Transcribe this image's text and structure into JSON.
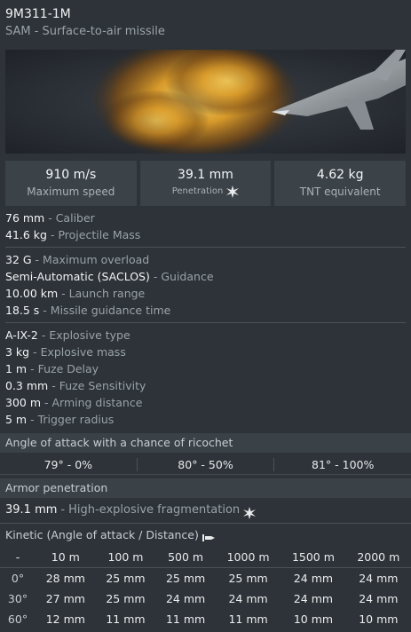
{
  "header": {
    "title": "9M311-1M",
    "subtitle": "SAM - Surface-to-air missile"
  },
  "image": {
    "icon": "missile-explosion-image"
  },
  "stats": [
    {
      "value": "910 m/s",
      "label": "Maximum speed"
    },
    {
      "value": "39.1 mm",
      "label": "Penetration",
      "icon": "he-burst-icon"
    },
    {
      "value": "4.62 kg",
      "label": "TNT equivalent"
    }
  ],
  "group1": [
    {
      "value": "76 mm",
      "key": "Caliber"
    },
    {
      "value": "41.6 kg",
      "key": "Projectile Mass"
    }
  ],
  "group2": [
    {
      "value": "32 G",
      "key": "Maximum overload"
    },
    {
      "value": "Semi-Automatic (SACLOS)",
      "key": "Guidance"
    },
    {
      "value": "10.00 km",
      "key": "Launch range"
    },
    {
      "value": "18.5 s",
      "key": "Missile guidance time"
    }
  ],
  "group3": [
    {
      "value": "A-IX-2",
      "key": "Explosive type"
    },
    {
      "value": "3 kg",
      "key": "Explosive mass"
    },
    {
      "value": "1 m",
      "key": "Fuze Delay"
    },
    {
      "value": "0.3 mm",
      "key": "Fuze Sensitivity"
    },
    {
      "value": "300 m",
      "key": "Arming distance"
    },
    {
      "value": "5 m",
      "key": "Trigger radius"
    }
  ],
  "ricochet": {
    "title": "Angle of attack with a chance of ricochet",
    "cells": [
      "79° - 0%",
      "80° - 50%",
      "81° - 100%"
    ]
  },
  "armor": {
    "title": "Armor penetration",
    "value": "39.1 mm",
    "key": "High-explosive fragmentation"
  },
  "kinetic": {
    "title": "Kinetic (Angle of attack / Distance)",
    "columns": [
      "-",
      "10 m",
      "100 m",
      "500 m",
      "1000 m",
      "1500 m",
      "2000 m"
    ],
    "rows": [
      {
        "angle": "0°",
        "values": [
          "28 mm",
          "25 mm",
          "25 mm",
          "25 mm",
          "24 mm",
          "24 mm"
        ]
      },
      {
        "angle": "30°",
        "values": [
          "27 mm",
          "25 mm",
          "24 mm",
          "24 mm",
          "24 mm",
          "24 mm"
        ]
      },
      {
        "angle": "60°",
        "values": [
          "12 mm",
          "11 mm",
          "11 mm",
          "11 mm",
          "10 mm",
          "10 mm"
        ]
      }
    ]
  }
}
